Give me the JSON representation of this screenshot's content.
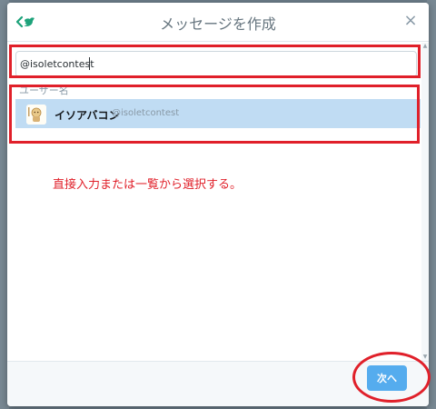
{
  "dialog": {
    "title": "メッセージを作成",
    "close_label": "×"
  },
  "recipient_input": {
    "value": "@isoletcontest",
    "placeholder": ""
  },
  "suggestions": {
    "section_label": "ユーザー名",
    "items": [
      {
        "name": "イソアバコン",
        "handle": "@isoletcontest"
      }
    ]
  },
  "annotation": {
    "note": "直接入力または一覧から選択する。"
  },
  "footer": {
    "next_label": "次へ"
  },
  "icons": {
    "logo": "twitter-message-logo-icon",
    "close": "close-icon",
    "avatar": "avatar"
  },
  "colors": {
    "accent": "#55acee",
    "selected_row": "#c0dcf3",
    "annotation_red": "#e0202a",
    "logo_green": "#1da27a"
  }
}
